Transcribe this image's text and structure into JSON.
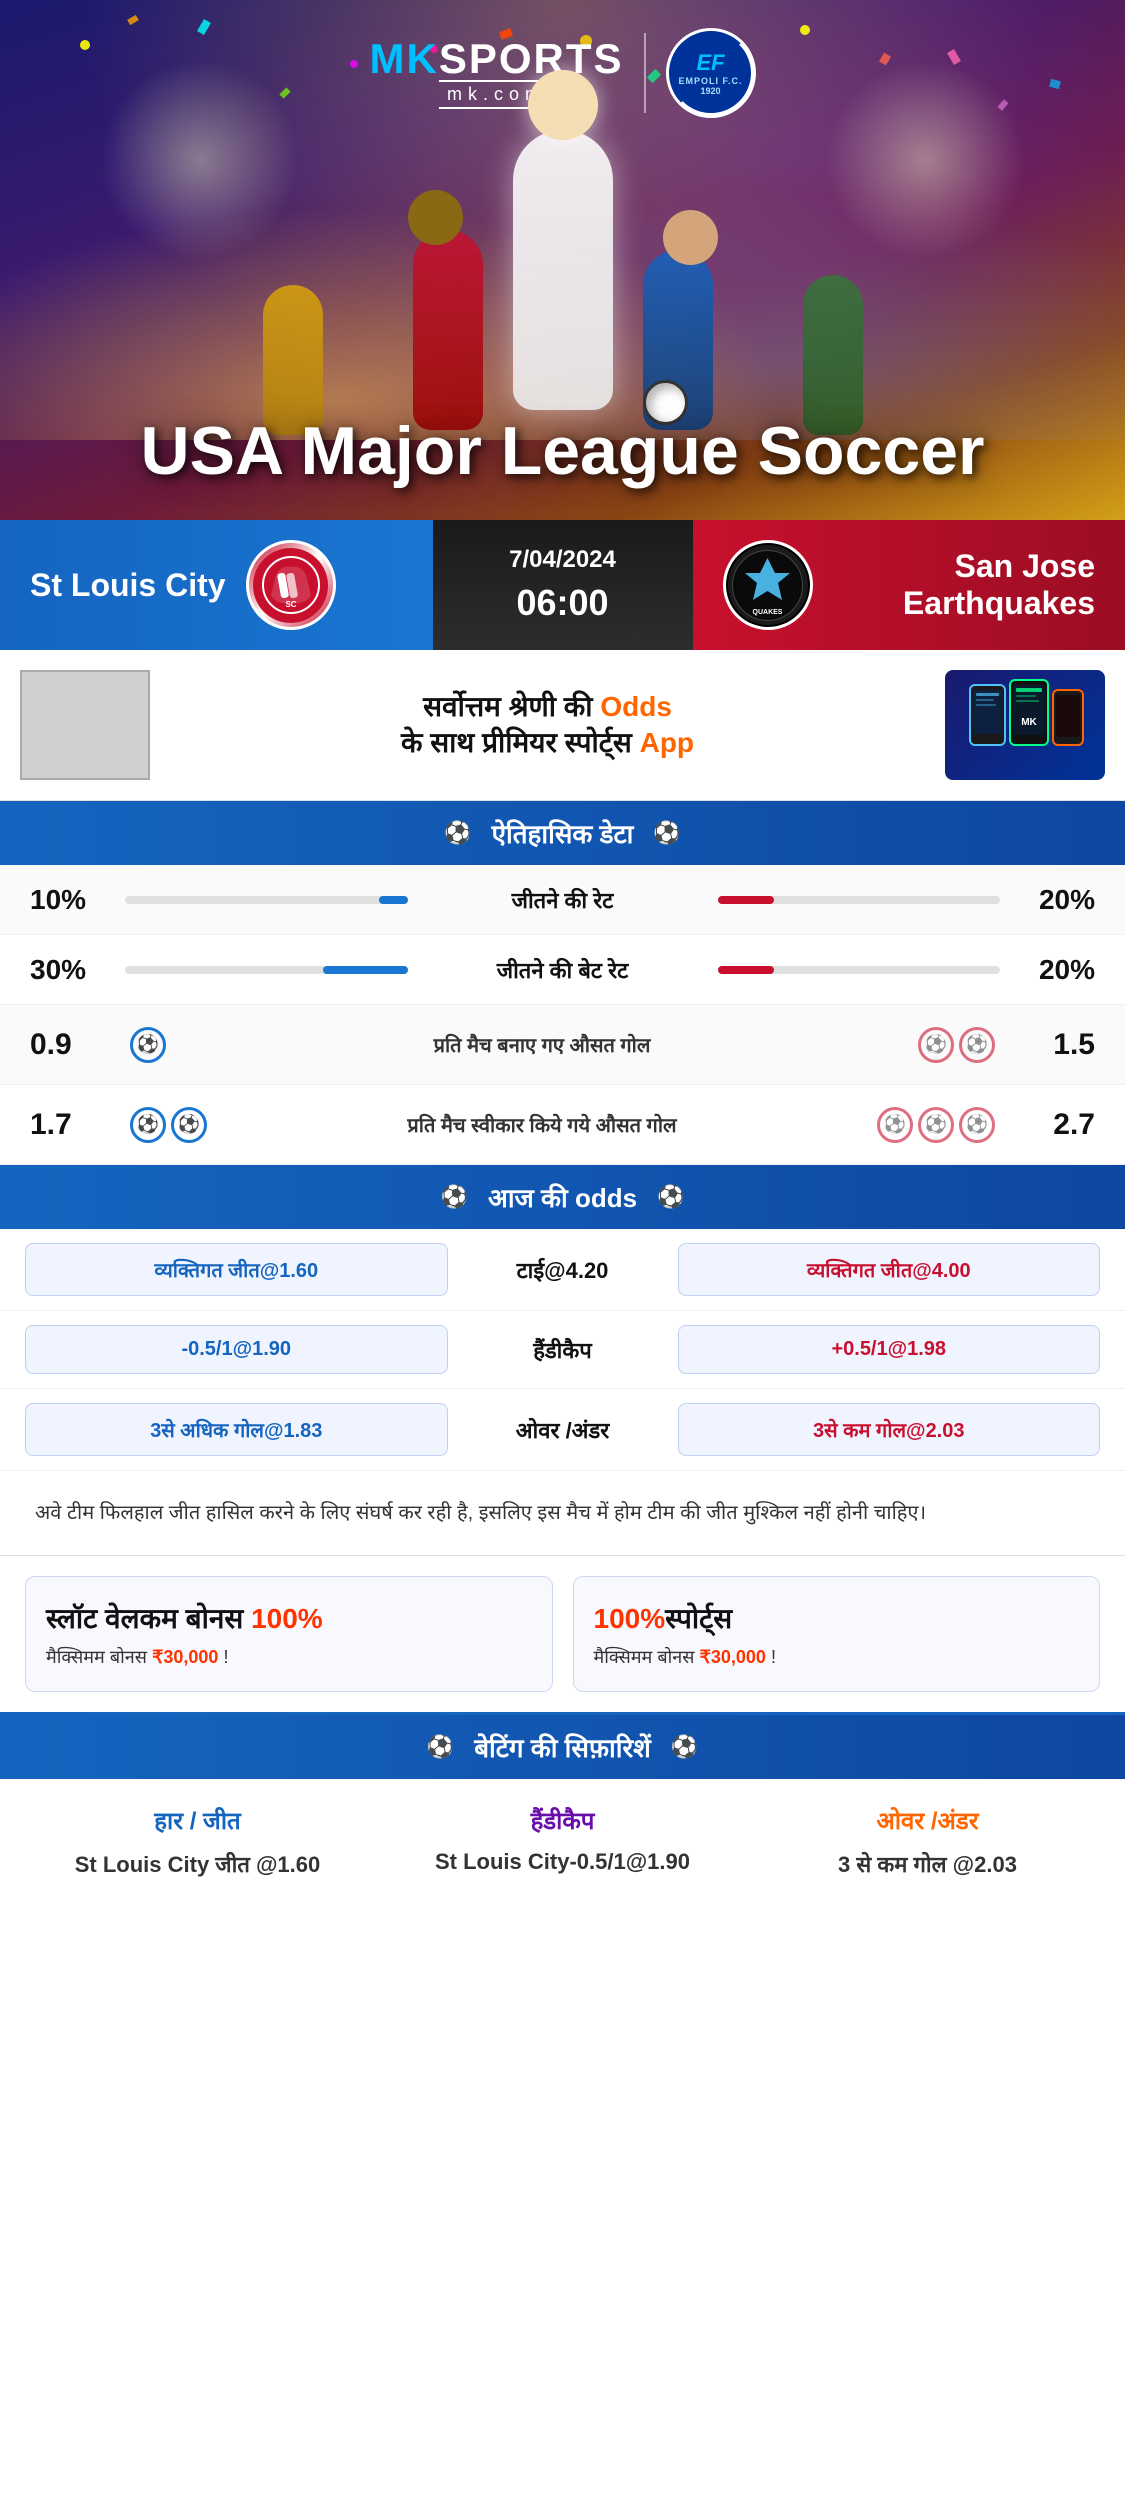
{
  "brand": {
    "name": "MK SPORTS",
    "domain": "mk.com",
    "partner": "EMPOLI F.C.",
    "partner_year": "1920"
  },
  "hero": {
    "title": "USA Major League Soccer"
  },
  "match": {
    "date": "7/04/2024",
    "time": "06:00",
    "home_team": "St Louis City",
    "away_team": "San Jose Earthquakes",
    "away_short": "QUAKES"
  },
  "promo": {
    "text_line1": "सर्वोत्तम श्रेणी की",
    "text_bold": "Odds",
    "text_line2": "के साथ प्रीमियर स्पोर्ट्स",
    "text_app": "App"
  },
  "historical": {
    "section_title": "ऐतिहासिक डेटा",
    "stats": [
      {
        "label": "जीतने की रेट",
        "left_value": "10%",
        "right_value": "20%",
        "left_pct": 10,
        "right_pct": 20
      },
      {
        "label": "जीतने की बेट रेट",
        "left_value": "30%",
        "right_value": "20%",
        "left_pct": 30,
        "right_pct": 20
      }
    ],
    "goal_stats": [
      {
        "label": "प्रति मैच बनाए गए औसत गोल",
        "left_value": "0.9",
        "right_value": "1.5",
        "left_balls": 1,
        "right_balls": 2
      },
      {
        "label": "प्रति मैच स्वीकार किये गये औसत गोल",
        "left_value": "1.7",
        "right_value": "2.7",
        "left_balls": 2,
        "right_balls": 3
      }
    ]
  },
  "odds": {
    "section_title": "आज की odds",
    "rows": [
      {
        "left_label": "व्यक्तिगत जीत@1.60",
        "center_label": "टाई@4.20",
        "right_label": "व्यक्तिगत जीत@4.00",
        "right_red": true
      },
      {
        "left_label": "-0.5/1@1.90",
        "center_label": "हैंडीकैप",
        "right_label": "+0.5/1@1.98",
        "right_red": true
      },
      {
        "left_label": "3से अधिक गोल@1.83",
        "center_label": "ओवर /अंडर",
        "right_label": "3से कम गोल@2.03",
        "right_red": true
      }
    ]
  },
  "analysis": {
    "text": "अवे टीम फिलहाल जीत हासिल करने के लिए संघर्ष कर रही है, इसलिए इस मैच में होम टीम की जीत मुश्किल नहीं होनी चाहिए।"
  },
  "bonus": [
    {
      "title_main": "स्लॉट वेलकम बोनस ",
      "percent": "100%",
      "subtitle": "मैक्सिमम बोनस ₹30,000  !"
    },
    {
      "title_main": "100%",
      "title_sport": "स्पोर्ट्स",
      "subtitle": "मैक्सिमम बोनस  ₹30,000 !"
    }
  ],
  "betting": {
    "section_title": "बेटिंग की सिफ़ारिशें",
    "cols": [
      {
        "title": "हार / जीत",
        "color": "blue",
        "value": "St Louis City जीत @1.60"
      },
      {
        "title": "हैंडीकैप",
        "color": "purple",
        "value": "St Louis City-0.5/1@1.90"
      },
      {
        "title": "ओवर /अंडर",
        "color": "orange",
        "value": "3 से कम गोल @2.03"
      }
    ]
  }
}
